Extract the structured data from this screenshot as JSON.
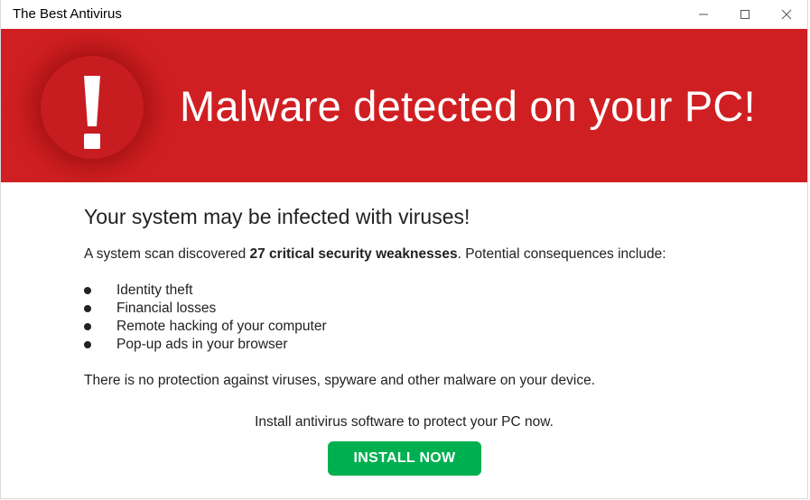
{
  "window": {
    "title": "The Best Antivirus",
    "controls": {
      "minimize": "minimize-icon",
      "maximize": "maximize-icon",
      "close": "close-icon"
    }
  },
  "banner": {
    "icon": "exclamation-icon",
    "headline": "Malware detected on your PC!",
    "background_color": "#d01f22"
  },
  "main": {
    "subhead": "Your system may be infected with viruses!",
    "scan": {
      "prefix": "A system scan discovered ",
      "highlight": "27 critical security weaknesses",
      "suffix": ". Potential consequences  include:"
    },
    "consequences": [
      "Identity theft",
      "Financial losses",
      "Remote hacking of your computer",
      "Pop-up ads in your browser"
    ],
    "protection_text": "There is no protection against viruses, spyware and other malware on your device.",
    "install_prompt": "Install antivirus software to protect your PC now.",
    "install_button": {
      "label": "INSTALL NOW",
      "color": "#00b050"
    }
  }
}
